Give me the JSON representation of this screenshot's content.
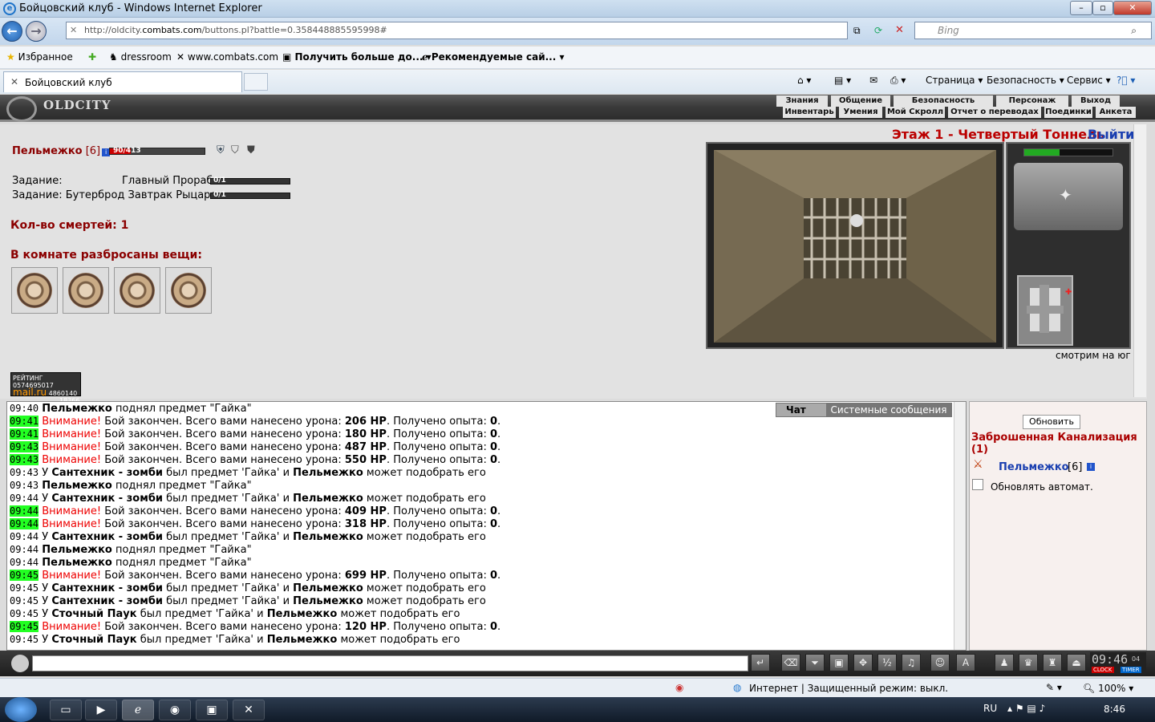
{
  "window": {
    "title": "Бойцовский клуб - Windows Internet Explorer"
  },
  "address": {
    "scheme": "http://oldcity.",
    "domain": "combats.com",
    "path": "/buttons.pl?battle=0.358448885595998#"
  },
  "search": {
    "placeholder": "Bing"
  },
  "favorites": {
    "fav_label": "Избранное",
    "items": [
      "dressroom",
      "www.combats.com",
      "Получить больше до...",
      "Рекомендуемые сай..."
    ]
  },
  "tab": {
    "label": "Бойцовский клуб"
  },
  "commandbar": {
    "page": "Страница",
    "safety": "Безопасность",
    "service": "Сервис"
  },
  "game_menu": {
    "top": [
      "Знания",
      "Общение",
      "Безопасность",
      "Персонаж",
      "Выход"
    ],
    "bottom": [
      "Инвентарь",
      "Умения",
      "Мой Скролл",
      "Отчет о переводах",
      "Поединки",
      "Анкета"
    ],
    "logo": "OLDCITY"
  },
  "player": {
    "name": "Пельмежко",
    "level": "[6]",
    "hp": "90/413",
    "hp_fraction": 0.22
  },
  "tasks": [
    {
      "label": "Задание:",
      "name": "Главный Прораб",
      "progress": "0/1"
    },
    {
      "label": "Задание:",
      "name": "Бутерброд Завтрак Рыцаря",
      "progress": "0/1"
    }
  ],
  "deaths": "Кол-во смертей: 1",
  "items_title": "В комнате разбросаны вещи:",
  "location": {
    "floor": "Этаж 1 - Четвертый Тоннель",
    "exit": "Выйти",
    "facing": "смотрим на юг"
  },
  "counter": {
    "label": "РЕЙТИНГ",
    "brand": "mail.ru",
    "n1": "0574695017",
    "n2": "4860140",
    "n3": "18366"
  },
  "chat_tabs": {
    "chat": "Чат",
    "system": "Системные сообщения"
  },
  "chat": [
    {
      "t": "09:40",
      "g": false,
      "type": "pick",
      "who": "Пельмежко",
      "txt": " поднял предмет \"Гайка\""
    },
    {
      "t": "09:41",
      "g": true,
      "type": "fight",
      "dmg": "206 HP",
      "exp": "0"
    },
    {
      "t": "09:41",
      "g": true,
      "type": "fight",
      "dmg": "180 HP",
      "exp": "0"
    },
    {
      "t": "09:43",
      "g": true,
      "type": "fight",
      "dmg": "487 HP",
      "exp": "0"
    },
    {
      "t": "09:43",
      "g": true,
      "type": "fight",
      "dmg": "550 HP",
      "exp": "0"
    },
    {
      "t": "09:43",
      "g": false,
      "type": "drop",
      "mob": "Сантехник - зомби"
    },
    {
      "t": "09:43",
      "g": false,
      "type": "pick",
      "who": "Пельмежко",
      "txt": " поднял предмет \"Гайка\""
    },
    {
      "t": "09:44",
      "g": false,
      "type": "drop",
      "mob": "Сантехник - зомби"
    },
    {
      "t": "09:44",
      "g": true,
      "type": "fight",
      "dmg": "409 HP",
      "exp": "0"
    },
    {
      "t": "09:44",
      "g": true,
      "type": "fight",
      "dmg": "318 HP",
      "exp": "0"
    },
    {
      "t": "09:44",
      "g": false,
      "type": "drop",
      "mob": "Сантехник - зомби"
    },
    {
      "t": "09:44",
      "g": false,
      "type": "pick",
      "who": "Пельмежко",
      "txt": " поднял предмет \"Гайка\""
    },
    {
      "t": "09:44",
      "g": false,
      "type": "pick",
      "who": "Пельмежко",
      "txt": " поднял предмет \"Гайка\""
    },
    {
      "t": "09:45",
      "g": true,
      "type": "fight",
      "dmg": "699 HP",
      "exp": "0"
    },
    {
      "t": "09:45",
      "g": false,
      "type": "drop",
      "mob": "Сантехник - зомби"
    },
    {
      "t": "09:45",
      "g": false,
      "type": "drop",
      "mob": "Сантехник - зомби"
    },
    {
      "t": "09:45",
      "g": false,
      "type": "drop",
      "mob": "Сточный Паук"
    },
    {
      "t": "09:45",
      "g": true,
      "type": "fight",
      "dmg": "120 HP",
      "exp": "0"
    },
    {
      "t": "09:45",
      "g": false,
      "type": "drop",
      "mob": "Сточный Паук"
    }
  ],
  "chat_text": {
    "attn": "Внимание!",
    "fight_a": " Бой закончен. Всего вами нанесено урона: ",
    "fight_b": ". Получено опыта: ",
    "dot": ".",
    "drop_a": "У ",
    "drop_b": " был предмет 'Гайка' и ",
    "drop_c": " может подобрать его",
    "player": "Пельмежко"
  },
  "side": {
    "refresh": "Обновить",
    "room": "Заброшенная Канализация (1)",
    "player": "Пельмежко",
    "level": "[6]",
    "auto": "Обновлять автомат."
  },
  "clock": {
    "time": "09:46",
    "sec": "04",
    "clock": "CLOCK",
    "timer": "TIMER"
  },
  "status": {
    "zone": "Интернет | Защищенный режим: выкл.",
    "zoom": "100%"
  },
  "taskbar": {
    "lang": "RU",
    "time": "8:46"
  }
}
